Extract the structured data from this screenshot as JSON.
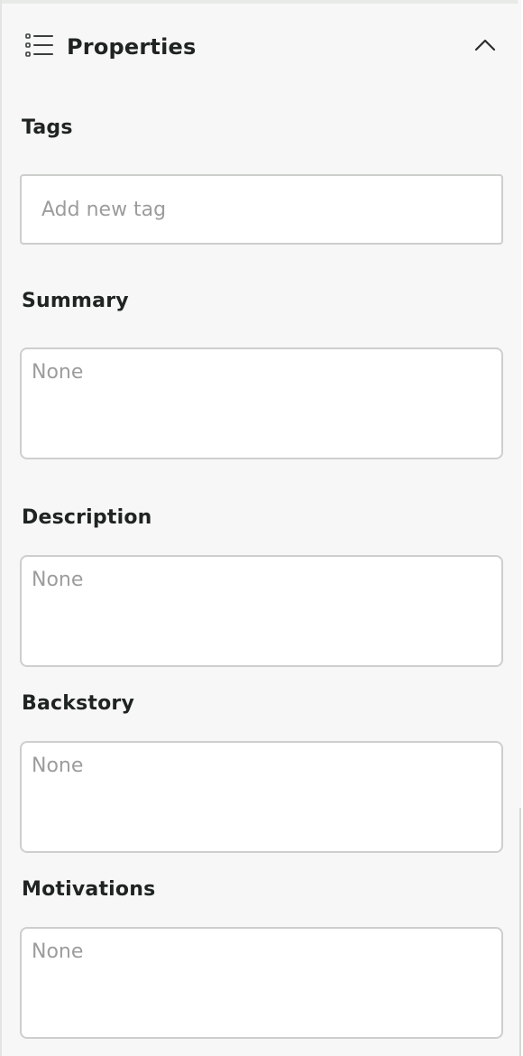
{
  "properties_panel": {
    "title": "Properties",
    "icon": "list-icon",
    "collapse_icon": "chevron-up-icon",
    "fields": {
      "tags": {
        "label": "Tags",
        "placeholder": "Add new tag"
      },
      "summary": {
        "label": "Summary",
        "placeholder": "None"
      },
      "description": {
        "label": "Description",
        "placeholder": "None"
      },
      "backstory": {
        "label": "Backstory",
        "placeholder": "None"
      },
      "motivations": {
        "label": "Motivations",
        "placeholder": "None"
      }
    }
  }
}
